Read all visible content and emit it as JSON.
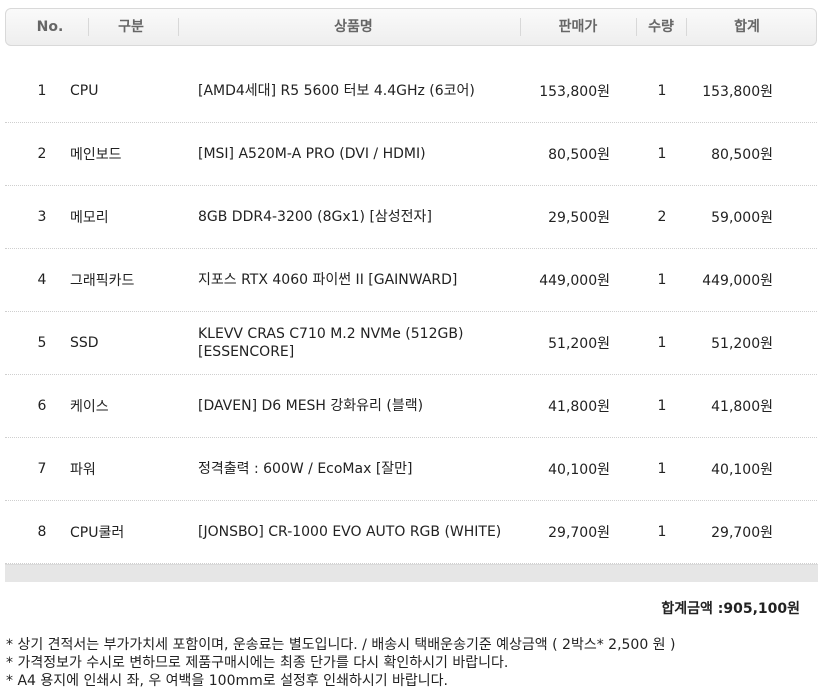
{
  "header": {
    "no": "No.",
    "category": "구분",
    "product": "상품명",
    "price": "판매가",
    "qty": "수량",
    "total": "합계"
  },
  "rows": [
    {
      "no": "1",
      "category": "CPU",
      "product": "[AMD4세대] R5 5600 터보 4.4GHz (6코어)",
      "price": "153,800원",
      "qty": "1",
      "total": "153,800원"
    },
    {
      "no": "2",
      "category": "메인보드",
      "product": "[MSI] A520M-A PRO (DVI / HDMI)",
      "price": "80,500원",
      "qty": "1",
      "total": "80,500원"
    },
    {
      "no": "3",
      "category": "메모리",
      "product": "8GB DDR4-3200 (8Gx1) [삼성전자]",
      "price": "29,500원",
      "qty": "2",
      "total": "59,000원"
    },
    {
      "no": "4",
      "category": "그래픽카드",
      "product": "지포스 RTX 4060 파이썬 II [GAINWARD]",
      "price": "449,000원",
      "qty": "1",
      "total": "449,000원"
    },
    {
      "no": "5",
      "category": "SSD",
      "product": "KLEVV CRAS C710 M.2 NVMe (512GB) [ESSENCORE]",
      "price": "51,200원",
      "qty": "1",
      "total": "51,200원"
    },
    {
      "no": "6",
      "category": "케이스",
      "product": "[DAVEN] D6 MESH 강화유리 (블랙)",
      "price": "41,800원",
      "qty": "1",
      "total": "41,800원"
    },
    {
      "no": "7",
      "category": "파워",
      "product": "정격출력 : 600W / EcoMax [잘만]",
      "price": "40,100원",
      "qty": "1",
      "total": "40,100원"
    },
    {
      "no": "8",
      "category": "CPU쿨러",
      "product": "[JONSBO] CR-1000 EVO AUTO RGB (WHITE)",
      "price": "29,700원",
      "qty": "1",
      "total": "29,700원"
    }
  ],
  "summary": {
    "grand_total": "합계금액 :905,100원"
  },
  "notes": [
    "* 상기 견적서는 부가가치세 포함이며, 운송료는 별도입니다. / 배송시 택배운송기준 예상금액 ( 2박스* 2,500 원 )",
    "* 가격정보가 수시로 변하므로 제품구매시에는 최종 단가를 다시 확인하시기 바랍니다.",
    "* A4 용지에 인쇄시 좌, 우 여백을 100mm로 설정후 인쇄하시기 바랍니다."
  ]
}
